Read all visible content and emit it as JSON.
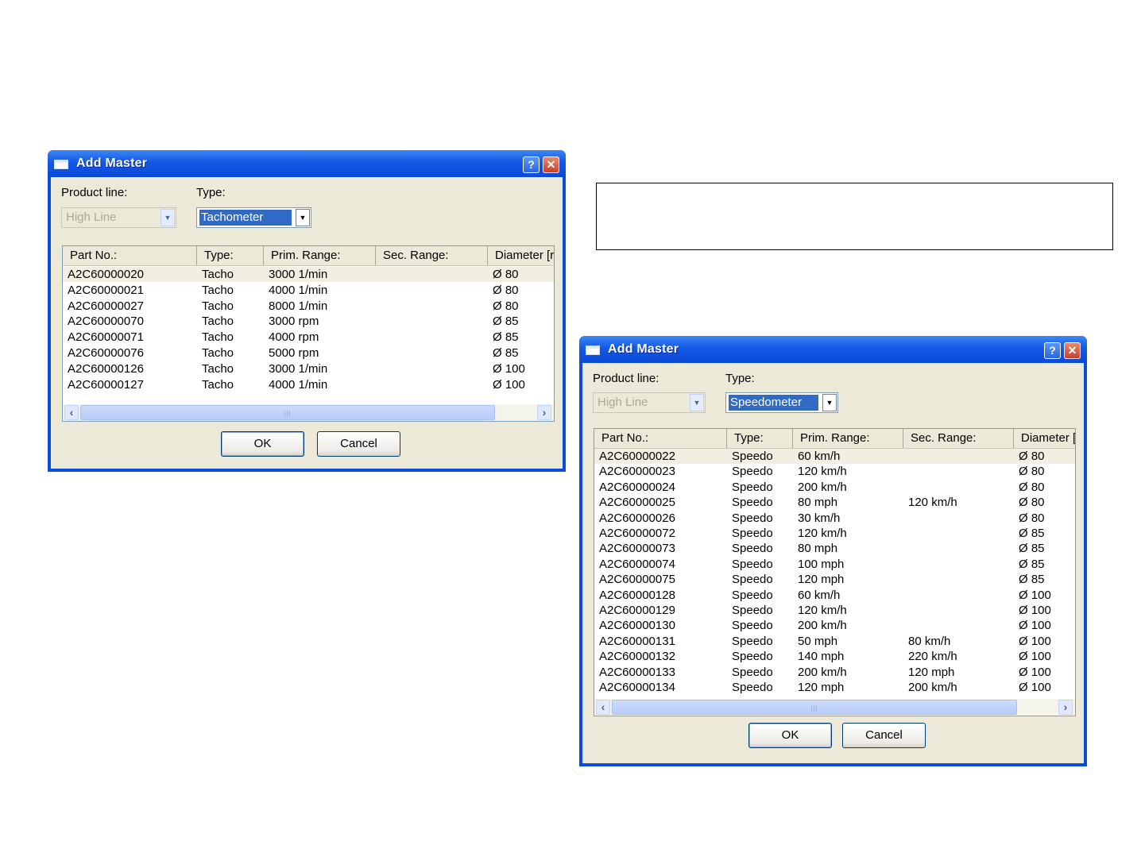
{
  "dialog1": {
    "title": "Add Master",
    "help_glyph": "?",
    "close_glyph": "✕",
    "product_line_label": "Product line:",
    "product_line_value": "High Line",
    "type_label": "Type:",
    "type_value": "Tachometer",
    "columns": [
      "Part No.:",
      "Type:",
      "Prim. Range:",
      "Sec. Range:",
      "Diameter [r"
    ],
    "rows": [
      [
        "A2C60000020",
        "Tacho",
        "3000 1/min",
        "",
        "Ø 80"
      ],
      [
        "A2C60000021",
        "Tacho",
        "4000 1/min",
        "",
        "Ø 80"
      ],
      [
        "A2C60000027",
        "Tacho",
        "8000 1/min",
        "",
        "Ø 80"
      ],
      [
        "A2C60000070",
        "Tacho",
        "3000 rpm",
        "",
        "Ø 85"
      ],
      [
        "A2C60000071",
        "Tacho",
        "4000 rpm",
        "",
        "Ø 85"
      ],
      [
        "A2C60000076",
        "Tacho",
        "5000 rpm",
        "",
        "Ø 85"
      ],
      [
        "A2C60000126",
        "Tacho",
        "3000 1/min",
        "",
        "Ø 100"
      ],
      [
        "A2C60000127",
        "Tacho",
        "4000 1/min",
        "",
        "Ø 100"
      ]
    ],
    "ok_label": "OK",
    "cancel_label": "Cancel"
  },
  "dialog2": {
    "title": "Add Master",
    "help_glyph": "?",
    "close_glyph": "✕",
    "product_line_label": "Product line:",
    "product_line_value": "High Line",
    "type_label": "Type:",
    "type_value": "Speedometer",
    "columns": [
      "Part No.:",
      "Type:",
      "Prim. Range:",
      "Sec. Range:",
      "Diameter [r"
    ],
    "rows": [
      [
        "A2C60000022",
        "Speedo",
        "60 km/h",
        "",
        "Ø 80"
      ],
      [
        "A2C60000023",
        "Speedo",
        "120 km/h",
        "",
        "Ø 80"
      ],
      [
        "A2C60000024",
        "Speedo",
        "200 km/h",
        "",
        "Ø 80"
      ],
      [
        "A2C60000025",
        "Speedo",
        "80 mph",
        "120 km/h",
        "Ø 80"
      ],
      [
        "A2C60000026",
        "Speedo",
        "30 km/h",
        "",
        "Ø 80"
      ],
      [
        "A2C60000072",
        "Speedo",
        "120 km/h",
        "",
        "Ø 85"
      ],
      [
        "A2C60000073",
        "Speedo",
        "80 mph",
        "",
        "Ø 85"
      ],
      [
        "A2C60000074",
        "Speedo",
        "100 mph",
        "",
        "Ø 85"
      ],
      [
        "A2C60000075",
        "Speedo",
        "120 mph",
        "",
        "Ø 85"
      ],
      [
        "A2C60000128",
        "Speedo",
        "60 km/h",
        "",
        "Ø 100"
      ],
      [
        "A2C60000129",
        "Speedo",
        "120 km/h",
        "",
        "Ø 100"
      ],
      [
        "A2C60000130",
        "Speedo",
        "200 km/h",
        "",
        "Ø 100"
      ],
      [
        "A2C60000131",
        "Speedo",
        "50 mph",
        "80 km/h",
        "Ø 100"
      ],
      [
        "A2C60000132",
        "Speedo",
        "140 mph",
        "220 km/h",
        "Ø 100"
      ],
      [
        "A2C60000133",
        "Speedo",
        "200 km/h",
        "120 mph",
        "Ø 100"
      ],
      [
        "A2C60000134",
        "Speedo",
        "120 mph",
        "200 km/h",
        "Ø 100"
      ]
    ],
    "ok_label": "OK",
    "cancel_label": "Cancel"
  },
  "icons": {
    "dropdown": "chevron-down-icon",
    "scroll_left": "scroll-left-icon",
    "scroll_right": "scroll-right-icon",
    "help": "help-icon",
    "close": "close-icon"
  },
  "colors": {
    "titlebar": "#0a4be0",
    "window_bg": "#ece9d8",
    "selection": "#316ac5"
  }
}
